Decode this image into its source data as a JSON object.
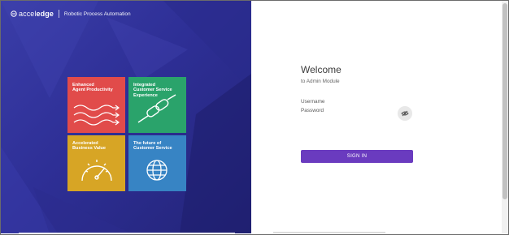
{
  "brand": {
    "logo_prefix": "accel",
    "logo_suffix": "edge",
    "product": "Robotic Process Automation"
  },
  "tiles": [
    {
      "title": "Enhanced\nAgent Productivity",
      "icon": "arrows-icon",
      "color": "#e14b4a"
    },
    {
      "title": "Integrated\nCustomer Service\nExperience",
      "icon": "chain-link-icon",
      "color": "#2aa36b"
    },
    {
      "title": "Accelerated\nBusiness Value",
      "icon": "speedometer-icon",
      "color": "#d7a525"
    },
    {
      "title": "The future of\nCustomer Service",
      "icon": "globe-icon",
      "color": "#3784c4"
    }
  ],
  "login": {
    "heading": "Welcome",
    "subheading": "to Admin Module",
    "username_label": "Username",
    "password_label": "Password",
    "signin_label": "SIGN IN",
    "accent": "#6a3bbf"
  }
}
